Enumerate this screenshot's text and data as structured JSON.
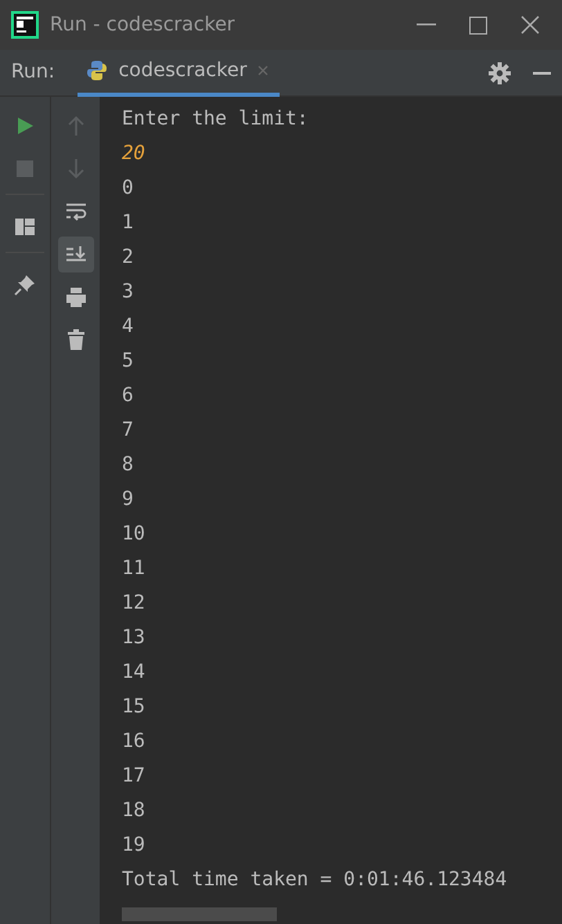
{
  "window": {
    "title": "Run - codescracker"
  },
  "run_bar": {
    "label": "Run:",
    "tabs": [
      {
        "label": "codescracker",
        "selected": true
      }
    ]
  },
  "toolbar_left": [
    {
      "kind": "rerun",
      "disabled": false
    },
    {
      "kind": "stop",
      "disabled": true
    },
    {
      "kind": "layout",
      "disabled": false
    },
    {
      "kind": "pin",
      "disabled": false
    }
  ],
  "toolbar_right": [
    {
      "kind": "up",
      "disabled": true,
      "selected": false
    },
    {
      "kind": "down",
      "disabled": true,
      "selected": false
    },
    {
      "kind": "wrap",
      "disabled": false,
      "selected": false
    },
    {
      "kind": "scroll-end",
      "disabled": false,
      "selected": true
    },
    {
      "kind": "print",
      "disabled": false,
      "selected": false
    },
    {
      "kind": "trash",
      "disabled": false,
      "selected": false
    }
  ],
  "console": [
    {
      "kind": "output",
      "text": "Enter the limit:"
    },
    {
      "kind": "input",
      "text": "20"
    },
    {
      "kind": "output",
      "text": "0"
    },
    {
      "kind": "output",
      "text": "1"
    },
    {
      "kind": "output",
      "text": "2"
    },
    {
      "kind": "output",
      "text": "3"
    },
    {
      "kind": "output",
      "text": "4"
    },
    {
      "kind": "output",
      "text": "5"
    },
    {
      "kind": "output",
      "text": "6"
    },
    {
      "kind": "output",
      "text": "7"
    },
    {
      "kind": "output",
      "text": "8"
    },
    {
      "kind": "output",
      "text": "9"
    },
    {
      "kind": "output",
      "text": "10"
    },
    {
      "kind": "output",
      "text": "11"
    },
    {
      "kind": "output",
      "text": "12"
    },
    {
      "kind": "output",
      "text": "13"
    },
    {
      "kind": "output",
      "text": "14"
    },
    {
      "kind": "output",
      "text": "15"
    },
    {
      "kind": "output",
      "text": "16"
    },
    {
      "kind": "output",
      "text": "17"
    },
    {
      "kind": "output",
      "text": "18"
    },
    {
      "kind": "output",
      "text": "19"
    },
    {
      "kind": "output",
      "text": "Total time taken = 0:01:46.123484"
    }
  ]
}
